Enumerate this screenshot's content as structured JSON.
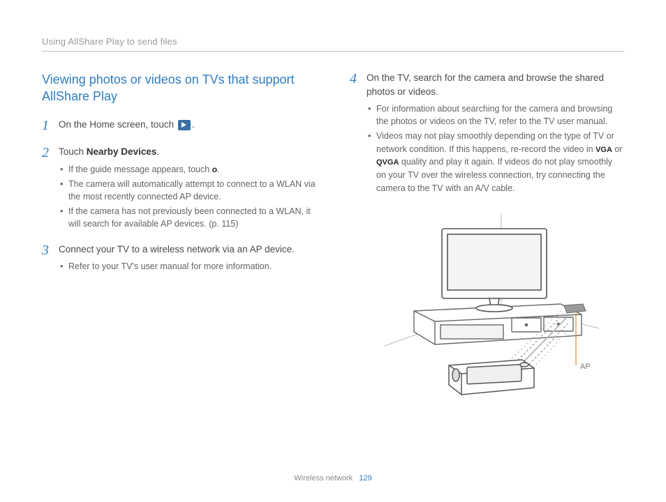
{
  "running_head": "Using AllShare Play to send files",
  "section_title": "Viewing photos or videos on TVs that support AllShare Play",
  "steps": {
    "s1": {
      "num": "1",
      "lead_a": "On the Home screen, touch ",
      "lead_b": "."
    },
    "s2": {
      "num": "2",
      "lead_a": "Touch ",
      "bold": "Nearby Devices",
      "lead_b": ".",
      "b1a": "If the guide message appears, touch ",
      "b1b": ".",
      "ok": "o",
      "b2": "The camera will automatically attempt to connect to a WLAN via the most recently connected AP device.",
      "b3": "If the camera has not previously been connected to a WLAN, it will search for available AP devices. (p. 115)"
    },
    "s3": {
      "num": "3",
      "lead": "Connect your TV to a wireless network via an AP device.",
      "b1": "Refer to your TV's user manual for more information."
    },
    "s4": {
      "num": "4",
      "lead": "On the TV, search for the camera and browse the shared photos or videos.",
      "b1": "For information about searching for the camera and browsing the photos or videos on the TV, refer to the TV user manual.",
      "b2a": "Videos may not play smoothly depending on the type of TV or network condition. If this happens, re-record the video in ",
      "vga": "VGA",
      "b2b": " or ",
      "qvga": "QVGA",
      "b2c": " quality and play it again. If videos do not play smoothly on your TV over the wireless connection, try connecting the camera to the TV with an A/V cable."
    }
  },
  "diagram": {
    "ap_label": "AP"
  },
  "footer": {
    "section": "Wireless network",
    "page": "129"
  }
}
